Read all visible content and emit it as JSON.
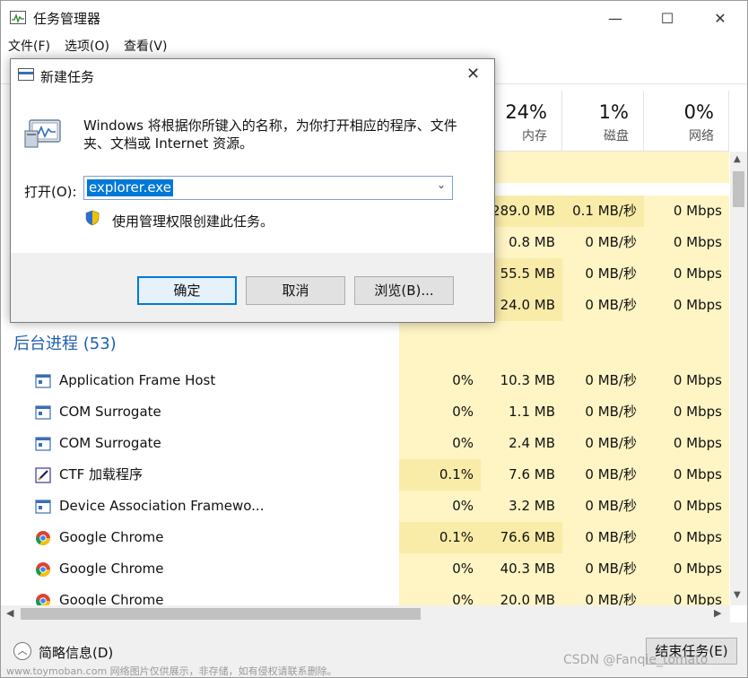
{
  "app": {
    "title": "任务管理器",
    "minimize": "—",
    "maximize": "☐",
    "close": "✕"
  },
  "menu": [
    "文件(F)",
    "选项(O)",
    "查看(V)"
  ],
  "columns": {
    "memory": {
      "pct": "24%",
      "name": "内存"
    },
    "disk": {
      "pct": "1%",
      "name": "磁盘"
    },
    "network": {
      "pct": "0%",
      "name": "网络"
    }
  },
  "top_rows": [
    {
      "mem": "289.0 MB",
      "disk": "0.1 MB/秒",
      "net": "0 Mbps"
    },
    {
      "mem": "0.8 MB",
      "disk": "0 MB/秒",
      "net": "0 Mbps"
    },
    {
      "mem": "55.5 MB",
      "disk": "0 MB/秒",
      "net": "0 Mbps"
    },
    {
      "mem": "24.0 MB",
      "disk": "0 MB/秒",
      "net": "0 Mbps"
    }
  ],
  "group": {
    "label": "后台进程 (53)"
  },
  "processes": [
    {
      "name": "Application Frame Host",
      "cpu": "0%",
      "mem": "10.3 MB",
      "disk": "0 MB/秒",
      "net": "0 Mbps",
      "icon": "window-icon"
    },
    {
      "name": "COM Surrogate",
      "cpu": "0%",
      "mem": "1.1 MB",
      "disk": "0 MB/秒",
      "net": "0 Mbps",
      "icon": "window-icon"
    },
    {
      "name": "COM Surrogate",
      "cpu": "0%",
      "mem": "2.4 MB",
      "disk": "0 MB/秒",
      "net": "0 Mbps",
      "icon": "window-icon"
    },
    {
      "name": "CTF 加载程序",
      "cpu": "0.1%",
      "mem": "7.6 MB",
      "disk": "0 MB/秒",
      "net": "0 Mbps",
      "icon": "pen-icon"
    },
    {
      "name": "Device Association Framewo...",
      "cpu": "0%",
      "mem": "3.2 MB",
      "disk": "0 MB/秒",
      "net": "0 Mbps",
      "icon": "window-icon"
    },
    {
      "name": "Google Chrome",
      "cpu": "0.1%",
      "mem": "76.6 MB",
      "disk": "0 MB/秒",
      "net": "0 Mbps",
      "icon": "chrome-icon"
    },
    {
      "name": "Google Chrome",
      "cpu": "0%",
      "mem": "40.3 MB",
      "disk": "0 MB/秒",
      "net": "0 Mbps",
      "icon": "chrome-icon"
    },
    {
      "name": "Google Chrome",
      "cpu": "0%",
      "mem": "20.0 MB",
      "disk": "0 MB/秒",
      "net": "0 Mbps",
      "icon": "chrome-icon"
    }
  ],
  "footer": {
    "fewer_details": "简略信息(D)",
    "end_task": "结束任务(E)",
    "watermark_left": "www.toymoban.com 网络图片仅供展示，非存储，如有侵权请联系删除。",
    "watermark_right": "CSDN @Fanqie_tomato"
  },
  "dialog": {
    "title": "新建任务",
    "close": "✕",
    "description": "Windows 将根据你所键入的名称，为你打开相应的程序、文件夹、文档或 Internet 资源。",
    "open_label": "打开(O):",
    "open_value": "explorer.exe",
    "admin_text": "使用管理权限创建此任务。",
    "ok": "确定",
    "cancel": "取消",
    "browse": "浏览(B)..."
  },
  "colors": {
    "heat_light": "#fff4c4",
    "heat_dark": "#f9eca8",
    "group_blue": "#1f5fb0",
    "selection_blue": "#0078d7"
  }
}
